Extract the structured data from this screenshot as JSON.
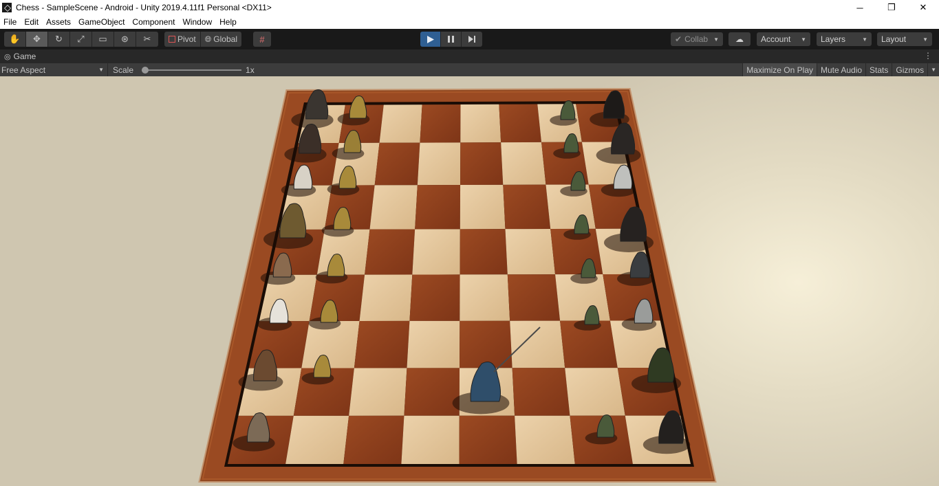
{
  "window": {
    "title": "Chess - SampleScene - Android - Unity 2019.4.11f1 Personal <DX11>",
    "controls": {
      "minimize": "─",
      "restore": "❐",
      "close": "✕"
    }
  },
  "menu": [
    "File",
    "Edit",
    "Assets",
    "GameObject",
    "Component",
    "Window",
    "Help"
  ],
  "toolbar": {
    "tools": [
      "hand-tool-icon",
      "move-tool-icon",
      "rotate-tool-icon",
      "scale-tool-icon",
      "rect-tool-icon",
      "transform-tool-icon",
      "custom-tool-icon"
    ],
    "pivot_label": "Pivot",
    "global_label": "Global",
    "collab_label": "Collab",
    "account_label": "Account",
    "layers_label": "Layers",
    "layout_label": "Layout"
  },
  "tab": {
    "label": "Game"
  },
  "gamebar": {
    "aspect": "Free Aspect",
    "scale_label": "Scale",
    "scale_value": "1x",
    "maximize": "Maximize On Play",
    "mute": "Mute Audio",
    "stats": "Stats",
    "gizmos": "Gizmos"
  },
  "colors": {
    "play_active": "#2f5f93",
    "board_dark": "#8a3c1c",
    "board_light": "#e3c49a",
    "frame": "#9a4a22"
  }
}
